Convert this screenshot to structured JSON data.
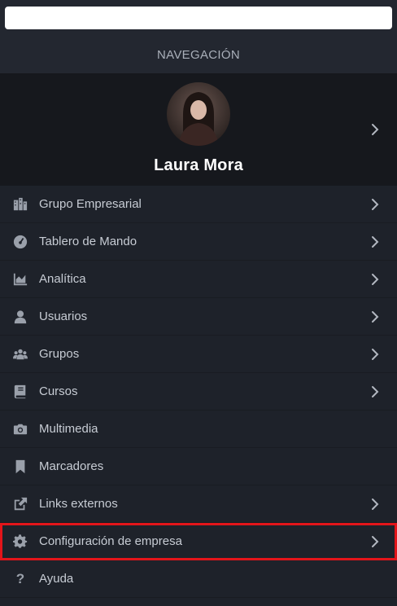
{
  "search": {
    "value": "",
    "placeholder": ""
  },
  "nav": {
    "header": "NAVEGACIÓN"
  },
  "profile": {
    "name": "Laura Mora"
  },
  "menu": [
    {
      "label": "Grupo Empresarial",
      "icon": "building-icon",
      "has_chevron": true
    },
    {
      "label": "Tablero de Mando",
      "icon": "dashboard-gauge-icon",
      "has_chevron": true
    },
    {
      "label": "Analítica",
      "icon": "area-chart-icon",
      "has_chevron": true
    },
    {
      "label": "Usuarios",
      "icon": "user-icon",
      "has_chevron": true
    },
    {
      "label": "Grupos",
      "icon": "users-group-icon",
      "has_chevron": true
    },
    {
      "label": "Cursos",
      "icon": "book-icon",
      "has_chevron": true
    },
    {
      "label": "Multimedia",
      "icon": "camera-icon",
      "has_chevron": false
    },
    {
      "label": "Marcadores",
      "icon": "bookmark-icon",
      "has_chevron": false
    },
    {
      "label": "Links externos",
      "icon": "external-link-icon",
      "has_chevron": true
    },
    {
      "label": "Configuración de empresa",
      "icon": "gear-icon",
      "has_chevron": true,
      "highlighted": true
    },
    {
      "label": "Ayuda",
      "icon": "question-icon",
      "has_chevron": false
    }
  ],
  "colors": {
    "background": "#1e222a",
    "profile_background": "#16181d",
    "highlight_border": "#e3151a",
    "text": "#c7ccd4",
    "icon": "#9aa0aa"
  }
}
